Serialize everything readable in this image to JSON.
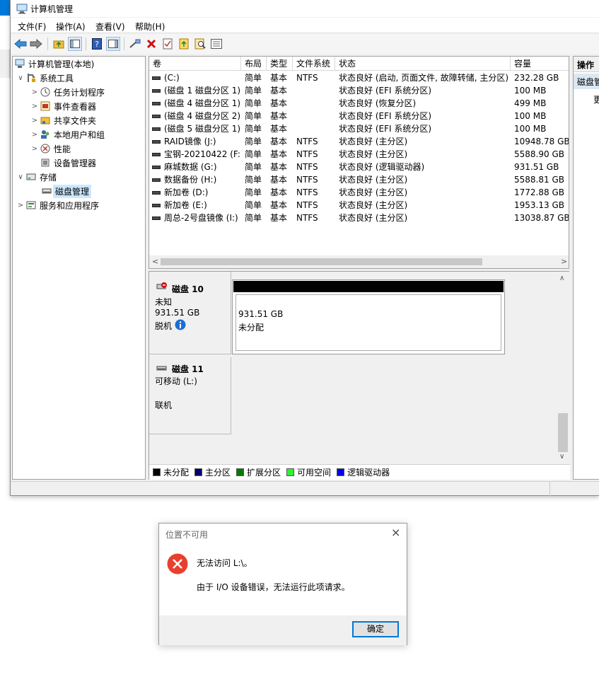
{
  "window": {
    "title": "计算机管理",
    "menu": [
      "文件(F)",
      "操作(A)",
      "查看(V)",
      "帮助(H)"
    ]
  },
  "tree": {
    "root": "计算机管理(本地)",
    "system_tools": "系统工具",
    "task_scheduler": "任务计划程序",
    "event_viewer": "事件查看器",
    "shared_folders": "共享文件夹",
    "local_users": "本地用户和组",
    "performance": "性能",
    "device_manager": "设备管理器",
    "storage": "存储",
    "disk_management": "磁盘管理",
    "services": "服务和应用程序"
  },
  "volume_list": {
    "columns": [
      "卷",
      "布局",
      "类型",
      "文件系统",
      "状态",
      "容量"
    ],
    "rows": [
      [
        "(C:)",
        "简单",
        "基本",
        "NTFS",
        "状态良好 (启动, 页面文件, 故障转储, 主分区)",
        "232.28 GB"
      ],
      [
        "(磁盘 1 磁盘分区 1)",
        "简单",
        "基本",
        "",
        "状态良好 (EFI 系统分区)",
        "100 MB"
      ],
      [
        "(磁盘 4 磁盘分区 1)",
        "简单",
        "基本",
        "",
        "状态良好 (恢复分区)",
        "499 MB"
      ],
      [
        "(磁盘 4 磁盘分区 2)",
        "简单",
        "基本",
        "",
        "状态良好 (EFI 系统分区)",
        "100 MB"
      ],
      [
        "(磁盘 5 磁盘分区 1)",
        "简单",
        "基本",
        "",
        "状态良好 (EFI 系统分区)",
        "100 MB"
      ],
      [
        "RAID镜像 (J:)",
        "简单",
        "基本",
        "NTFS",
        "状态良好 (主分区)",
        "10948.78 GB"
      ],
      [
        "宝钢-20210422 (F:)",
        "简单",
        "基本",
        "NTFS",
        "状态良好 (主分区)",
        "5588.90 GB"
      ],
      [
        "麻城数据 (G:)",
        "简单",
        "基本",
        "NTFS",
        "状态良好 (逻辑驱动器)",
        "931.51 GB"
      ],
      [
        "数据备份 (H:)",
        "简单",
        "基本",
        "NTFS",
        "状态良好 (主分区)",
        "5588.81 GB"
      ],
      [
        "新加卷 (D:)",
        "简单",
        "基本",
        "NTFS",
        "状态良好 (主分区)",
        "1772.88 GB"
      ],
      [
        "新加卷 (E:)",
        "简单",
        "基本",
        "NTFS",
        "状态良好 (主分区)",
        "1953.13 GB"
      ],
      [
        "周总-2号盘镜像 (I:)",
        "简单",
        "基本",
        "NTFS",
        "状态良好 (主分区)",
        "13038.87 GB"
      ]
    ]
  },
  "disk10": {
    "name": "磁盘 10",
    "type": "未知",
    "size": "931.51 GB",
    "state": "脱机",
    "part_size": "931.51 GB",
    "part_state": "未分配"
  },
  "disk11": {
    "name": "磁盘 11",
    "type": "可移动 (L:)",
    "state": "联机"
  },
  "legend": [
    {
      "label": "未分配",
      "color": "#000000"
    },
    {
      "label": "主分区",
      "color": "#00006e"
    },
    {
      "label": "扩展分区",
      "color": "#007a00"
    },
    {
      "label": "可用空间",
      "color": "#33ee33"
    },
    {
      "label": "逻辑驱动器",
      "color": "#0000ee"
    }
  ],
  "actions": {
    "title": "操作",
    "item": "磁盘管",
    "sub": "更"
  },
  "dialog": {
    "title": "位置不可用",
    "message": "无法访问 L:\\。",
    "detail": "由于 I/O 设备错误，无法运行此项请求。",
    "ok": "确定"
  }
}
